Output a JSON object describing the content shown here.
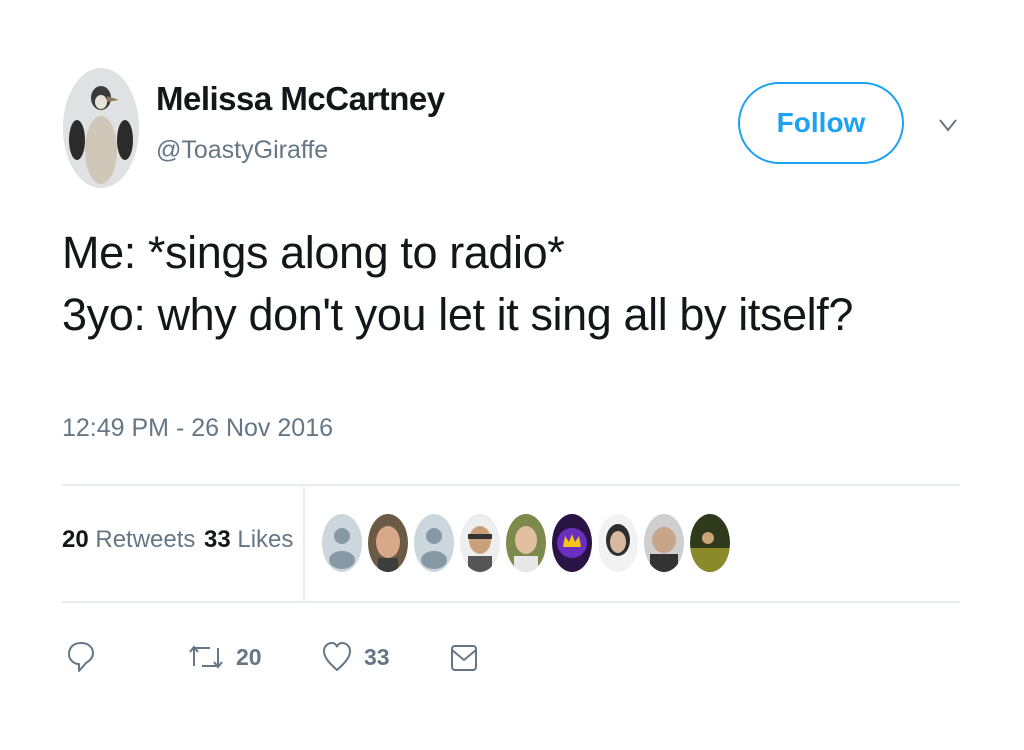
{
  "user": {
    "display_name": "Melissa McCartney",
    "handle": "@ToastyGiraffe",
    "avatar_icon": "penguin-avatar"
  },
  "follow_button": {
    "label": "Follow",
    "color": "#1da1f2"
  },
  "tweet": {
    "lines": [
      "Me: *sings along to radio*",
      "3yo: why don't you let it sing all by itself?"
    ],
    "timestamp": "12:49 PM - 26 Nov 2016"
  },
  "stats": {
    "retweets_count": "20",
    "retweets_label": " Retweets",
    "likes_count": "33",
    "likes_label": " Likes"
  },
  "actions": {
    "reply_icon": "reply-icon",
    "retweet_icon": "retweet-icon",
    "retweet_count": "20",
    "like_icon": "heart-icon",
    "like_count": "33",
    "dm_icon": "direct-message-icon"
  },
  "colors": {
    "text_primary": "#14171a",
    "text_secondary": "#657786",
    "accent": "#1da1f2",
    "divider": "#e6ecf0"
  }
}
